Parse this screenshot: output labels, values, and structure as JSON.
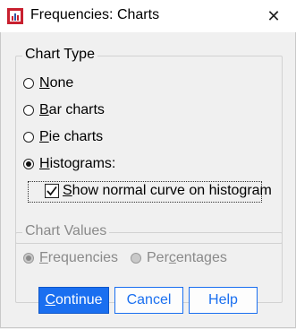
{
  "window": {
    "title": "Frequencies: Charts",
    "close_glyph": "✕"
  },
  "chart_type": {
    "label": "Chart Type",
    "options": [
      {
        "accel": "N",
        "rest": "one",
        "selected": false
      },
      {
        "accel": "B",
        "rest": "ar charts",
        "selected": false
      },
      {
        "accel": "P",
        "rest": "ie charts",
        "selected": false
      },
      {
        "accel": "H",
        "rest": "istograms:",
        "selected": true
      }
    ],
    "normal_curve": {
      "accel": "S",
      "rest": "how normal curve on histogram",
      "checked": true
    }
  },
  "chart_values": {
    "label": "Chart Values",
    "enabled": false,
    "options": [
      {
        "accel": "F",
        "rest": "requencies",
        "selected": true
      },
      {
        "pre": "Per",
        "accel": "c",
        "rest": "entages",
        "selected": false
      }
    ]
  },
  "buttons": {
    "continue": {
      "accel": "C",
      "rest": "ontinue"
    },
    "cancel": "Cancel",
    "help": "Help"
  },
  "colors": {
    "accent": "#1a6ff0",
    "disabled_text": "#8a8a8a"
  }
}
